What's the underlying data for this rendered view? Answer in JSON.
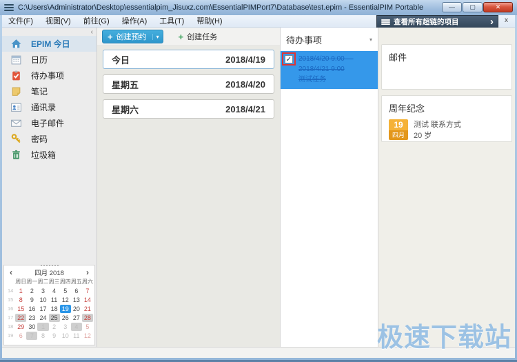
{
  "window": {
    "title": "C:\\Users\\Administrator\\Desktop\\essentialpim_Jisuxz.com\\EssentialPIMPort7\\Database\\test.epim - EssentialPIM Portable",
    "controls": {
      "minimize": "—",
      "maximize": "▢",
      "close": "✕"
    }
  },
  "menu": {
    "items": [
      "文件(F)",
      "视图(V)",
      "前往(G)",
      "操作(A)",
      "工具(T)",
      "帮助(H)"
    ]
  },
  "banner": {
    "label": "查看所有超链的项目",
    "chevron": "›",
    "close": "x"
  },
  "sidebar": {
    "collapse": "‹",
    "items": [
      {
        "label": "EPIM 今日",
        "icon": "home-icon",
        "selected": true
      },
      {
        "label": "日历",
        "icon": "calendar-icon",
        "selected": false
      },
      {
        "label": "待办事项",
        "icon": "todo-icon",
        "selected": false
      },
      {
        "label": "笔记",
        "icon": "notes-icon",
        "selected": false
      },
      {
        "label": "通讯录",
        "icon": "contacts-icon",
        "selected": false
      },
      {
        "label": "电子邮件",
        "icon": "mail-icon",
        "selected": false
      },
      {
        "label": "密码",
        "icon": "key-icon",
        "selected": false
      },
      {
        "label": "垃圾箱",
        "icon": "trash-icon",
        "selected": false
      }
    ]
  },
  "toolbar": {
    "new_appointment": "创建预约",
    "new_task": "创建任务",
    "dropdown_caret": "▾"
  },
  "today_view": {
    "days": [
      {
        "label": "今日",
        "date": "2018/4/19",
        "today": true
      },
      {
        "label": "星期五",
        "date": "2018/4/20",
        "today": false
      },
      {
        "label": "星期六",
        "date": "2018/4/21",
        "today": false
      }
    ]
  },
  "todo_panel": {
    "title": "待办事项",
    "caret": "▾",
    "items": [
      {
        "checked": true,
        "lines": [
          "2018/4/20 9:00 —",
          "2018/4/21 9:00",
          "测试任务"
        ],
        "selected": true,
        "annotated": true
      }
    ]
  },
  "right_panels": {
    "mail_title": "邮件",
    "anniversary": {
      "title": "周年纪念",
      "badge_day": "19",
      "badge_month": "四月",
      "name": "测试 联系方式",
      "age": "20 岁"
    }
  },
  "mini_calendar": {
    "prev": "‹",
    "next": "›",
    "month": "四月",
    "year": "2018",
    "weekdays": [
      "周日",
      "周一",
      "周二",
      "周三",
      "周四",
      "周五",
      "周六"
    ],
    "weeks": [
      {
        "num": 14,
        "days": [
          {
            "d": 1,
            "c": "we"
          },
          {
            "d": 2,
            "c": ""
          },
          {
            "d": 3,
            "c": ""
          },
          {
            "d": 4,
            "c": ""
          },
          {
            "d": 5,
            "c": ""
          },
          {
            "d": 6,
            "c": ""
          },
          {
            "d": 7,
            "c": "we"
          }
        ]
      },
      {
        "num": 15,
        "days": [
          {
            "d": 8,
            "c": "we"
          },
          {
            "d": 9,
            "c": ""
          },
          {
            "d": 10,
            "c": ""
          },
          {
            "d": 11,
            "c": ""
          },
          {
            "d": 12,
            "c": ""
          },
          {
            "d": 13,
            "c": ""
          },
          {
            "d": 14,
            "c": "we"
          }
        ]
      },
      {
        "num": 16,
        "days": [
          {
            "d": 15,
            "c": "we"
          },
          {
            "d": 16,
            "c": ""
          },
          {
            "d": 17,
            "c": ""
          },
          {
            "d": 18,
            "c": ""
          },
          {
            "d": 19,
            "c": "sel"
          },
          {
            "d": 20,
            "c": ""
          },
          {
            "d": 21,
            "c": "we"
          }
        ]
      },
      {
        "num": 17,
        "days": [
          {
            "d": 22,
            "c": "we ev"
          },
          {
            "d": 23,
            "c": ""
          },
          {
            "d": 24,
            "c": ""
          },
          {
            "d": 25,
            "c": "ev"
          },
          {
            "d": 26,
            "c": ""
          },
          {
            "d": 27,
            "c": ""
          },
          {
            "d": 28,
            "c": "we ev"
          }
        ]
      },
      {
        "num": 18,
        "days": [
          {
            "d": 29,
            "c": "we"
          },
          {
            "d": 30,
            "c": ""
          },
          {
            "d": 1,
            "c": "out ev"
          },
          {
            "d": 2,
            "c": "out"
          },
          {
            "d": 3,
            "c": "out"
          },
          {
            "d": 4,
            "c": "out ev"
          },
          {
            "d": 5,
            "c": "out we"
          }
        ]
      },
      {
        "num": 19,
        "days": [
          {
            "d": 6,
            "c": "out we"
          },
          {
            "d": 7,
            "c": "out ev"
          },
          {
            "d": 8,
            "c": "out"
          },
          {
            "d": 9,
            "c": "out"
          },
          {
            "d": 10,
            "c": "out"
          },
          {
            "d": 11,
            "c": "out"
          },
          {
            "d": 12,
            "c": "out we"
          }
        ]
      }
    ]
  },
  "watermark": "极速下载站",
  "colors": {
    "accent_blue": "#38a0d8",
    "selected_todo_blue": "#3598ea",
    "banner_navy": "#3c5168",
    "annotation_red": "#e03434",
    "badge_orange": "#f5b237",
    "weekend_red": "#c74440",
    "today_highlight": "#2b96e8"
  }
}
